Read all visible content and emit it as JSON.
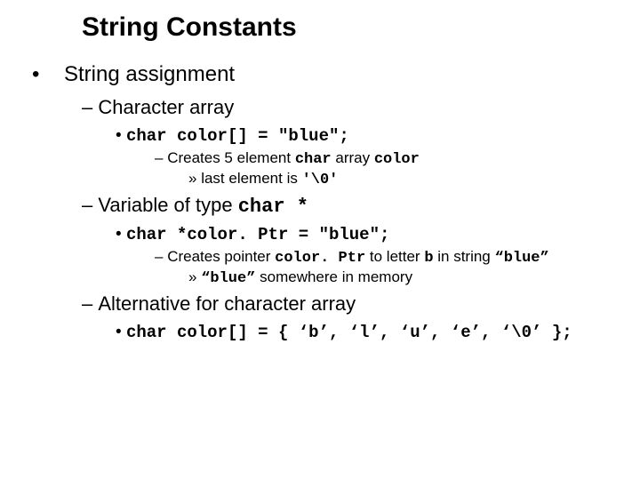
{
  "title": "String Constants",
  "l1": "String assignment",
  "l2a": "Character array",
  "l3a": "char color[] = \"blue\";",
  "l4a_pre": "Creates 5 element ",
  "l4a_mid": "char",
  "l4a_mid2": " array ",
  "l4a_end": "color",
  "l5a_pre": "last element is ",
  "l5a_code": "'\\0'",
  "l2b_pre": "Variable of type ",
  "l2b_code": "char *",
  "l3b": "char *color. Ptr = \"blue\";",
  "l4b_pre": "Creates pointer ",
  "l4b_c1": "color. Ptr",
  "l4b_mid": " to letter ",
  "l4b_c2": "b",
  "l4b_mid2": " in string ",
  "l4b_c3": "“blue”",
  "l5b_code": "“blue”",
  "l5b_post": " somewhere in memory",
  "l2c": "Alternative for character array",
  "l3c": "char color[] = { ‘b’, ‘l’, ‘u’, ‘e’, ‘\\0’ };"
}
